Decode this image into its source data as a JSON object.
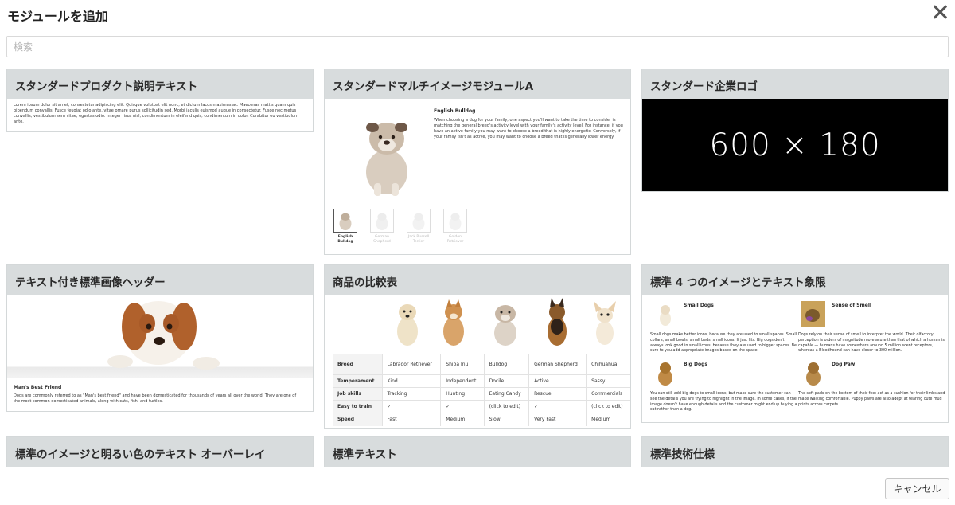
{
  "dialog": {
    "title": "モジュールを追加"
  },
  "search": {
    "placeholder": "検索",
    "value": ""
  },
  "cards": [
    {
      "title": "スタンダードプロダクト説明テキスト",
      "text": "Lorem ipsum dolor sit amet, consectetur adipiscing elit. Quisque volutpat elit nunc, et dictum lacus maximus ac. Maecenas mattis quam quis bibendum convallis. Fusce feugiat odio ante, vitae ornare purus sollicitudin sed. Morbi iaculis euismod augue in consectetur. Fusce nec metus convallis, vestibulum sem vitae, egestas odio. Integer risus nisl, condimentum in eleifend quis, condimentum in dolor. Curabitur eu vestibulum ante."
    },
    {
      "title": "スタンダードマルチイメージモジュールA",
      "heading": "English Bulldog",
      "text": "When choosing a dog for your family, one aspect you'll want to take the time to consider is matching the general breed's activity level with your family's activity level. For instance, if you have an active family you may want to choose a breed that is highly energetic. Conversely, if your family isn't as active, you may want to choose a breed that is generally lower energy.",
      "thumbs": [
        {
          "label": "English Bulldog"
        },
        {
          "label": "German Shepherd"
        },
        {
          "label": "Jack Russell Terrier"
        },
        {
          "label": "Golden Retriever"
        }
      ]
    },
    {
      "title": "スタンダード企業ロゴ",
      "placeholder": "600 × 180"
    },
    {
      "title": "テキスト付き標準画像ヘッダー",
      "caption_title": "Man's Best Friend",
      "caption_text": "Dogs are commonly referred to as \"Man's best friend\" and have been domesticated for thousands of years all over the world. They are one of the most common domesticated animals, along with cats, fish, and turtles."
    },
    {
      "title": "商品の比較表",
      "table": {
        "rows": [
          {
            "label": "Breed",
            "cells": [
              "Labrador Retriever",
              "Shiba Inu",
              "Bulldog",
              "German Shepherd",
              "Chihuahua"
            ]
          },
          {
            "label": "Temperament",
            "cells": [
              "Kind",
              "Independent",
              "Docile",
              "Active",
              "Sassy"
            ]
          },
          {
            "label": "Job skills",
            "cells": [
              "Tracking",
              "Hunting",
              "Eating Candy",
              "Rescue",
              "Commercials"
            ]
          },
          {
            "label": "Easy to train",
            "cells": [
              "✓",
              "✓",
              "(click to edit)",
              "✓",
              "(click to edit)"
            ]
          },
          {
            "label": "Speed",
            "cells": [
              "Fast",
              "Medium",
              "Slow",
              "Very Fast",
              "Medium"
            ]
          }
        ]
      }
    },
    {
      "title": "標準 4 つのイメージとテキスト象限",
      "quadrants": [
        {
          "title": "Small Dogs",
          "text": "Small dogs make better icons, because they are used to small spaces. Small collars, small bowls, small beds, small icons. It just fits. Big dogs don't always look good in small icons, because they are used to bigger spaces. Be sure to you add appropriate images based on the space."
        },
        {
          "title": "Sense of Smell",
          "text": "Dogs rely on their sense of smell to interpret the world. Their olfactory perception is orders of magnitude more acute than that of which a human is capable — humans have somewhere around 5 million scent receptors, whereas a Bloodhound can have closer to 300 million."
        },
        {
          "title": "Big Dogs",
          "text": "You can still add big dogs to small icons, but make sure the customer can see the details you are trying to highlight in the image. In some cases, if the image doesn't have enough details and the customer might end up buying a cat rather than a dog."
        },
        {
          "title": "Dog Paw",
          "text": "The soft pads on the bottom of their feet act as a cushion for their limbs and make walking comfortable. Puppy paws are also adept at tearing cute mud prints across carpets."
        }
      ]
    },
    {
      "title": "標準のイメージと明るい色のテキスト オーバーレイ"
    },
    {
      "title": "標準テキスト"
    },
    {
      "title": "標準技術仕様"
    }
  ],
  "footer": {
    "cancel_label": "キャンセル"
  }
}
